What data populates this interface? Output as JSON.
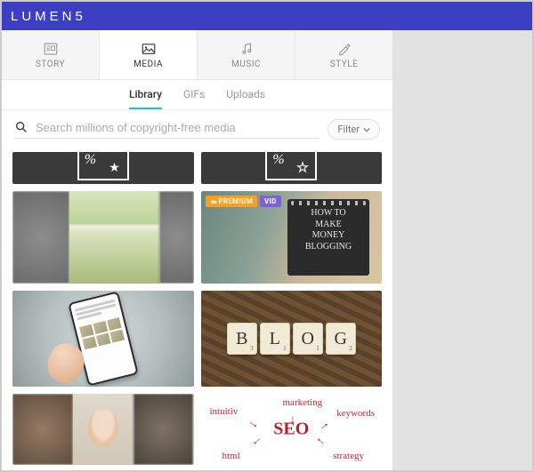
{
  "brand": {
    "name": "LUMEN5"
  },
  "main_tabs": {
    "story": "STORY",
    "media": "MEDIA",
    "music": "MUSIC",
    "style": "STYLE",
    "active": "media"
  },
  "sub_tabs": {
    "library": "Library",
    "gifs": "GIFs",
    "uploads": "Uploads",
    "active": "library"
  },
  "search": {
    "placeholder": "Search millions of copyright-free media",
    "filter_label": "Filter"
  },
  "badges": {
    "premium": "PREMIUM",
    "vid": "VID"
  },
  "media_items": {
    "notepad_text_l1": "HOW TO",
    "notepad_text_l2": "MAKE",
    "notepad_text_l3": "MONEY",
    "notepad_text_l4": "BLOGGING",
    "scrabble": [
      "B",
      "L",
      "O",
      "G"
    ],
    "seo_center": "SEO",
    "seo_words": {
      "intuitiv": "intuitiv",
      "marketing": "marketing",
      "keywords": "keywords",
      "html": "html",
      "strategy": "strategy"
    }
  }
}
